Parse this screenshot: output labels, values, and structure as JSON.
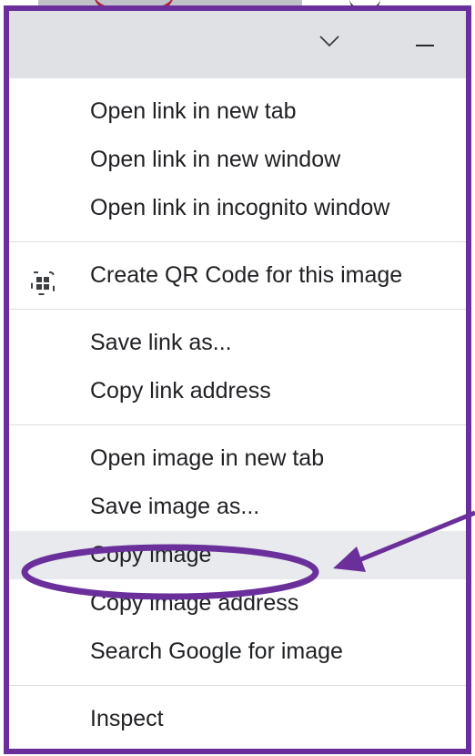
{
  "menu": {
    "groups": [
      {
        "items": [
          {
            "label": "Open link in new tab"
          },
          {
            "label": "Open link in new window"
          },
          {
            "label": "Open link in incognito window"
          }
        ]
      },
      {
        "items": [
          {
            "label": "Create QR Code for this image",
            "icon": "qr-code-icon"
          }
        ]
      },
      {
        "items": [
          {
            "label": "Save link as..."
          },
          {
            "label": "Copy link address"
          }
        ]
      },
      {
        "items": [
          {
            "label": "Open image in new tab"
          },
          {
            "label": "Save image as..."
          },
          {
            "label": "Copy image",
            "highlighted": true
          },
          {
            "label": "Copy image address"
          },
          {
            "label": "Search Google for image"
          }
        ]
      },
      {
        "items": [
          {
            "label": "Inspect"
          }
        ]
      }
    ]
  },
  "titlebar": {
    "icons": [
      "chevron-down-icon",
      "minimize-icon"
    ]
  },
  "annotation": {
    "frame_color": "#6b2f9c",
    "circle_color": "#6b2f9c",
    "arrow_color": "#6b2f9c",
    "target": "Copy image"
  },
  "colors": {
    "menu_text": "#202124",
    "hover_bg": "#e8eaed",
    "separator": "#dadce0",
    "titlebar_bg": "#dfe1e5"
  }
}
